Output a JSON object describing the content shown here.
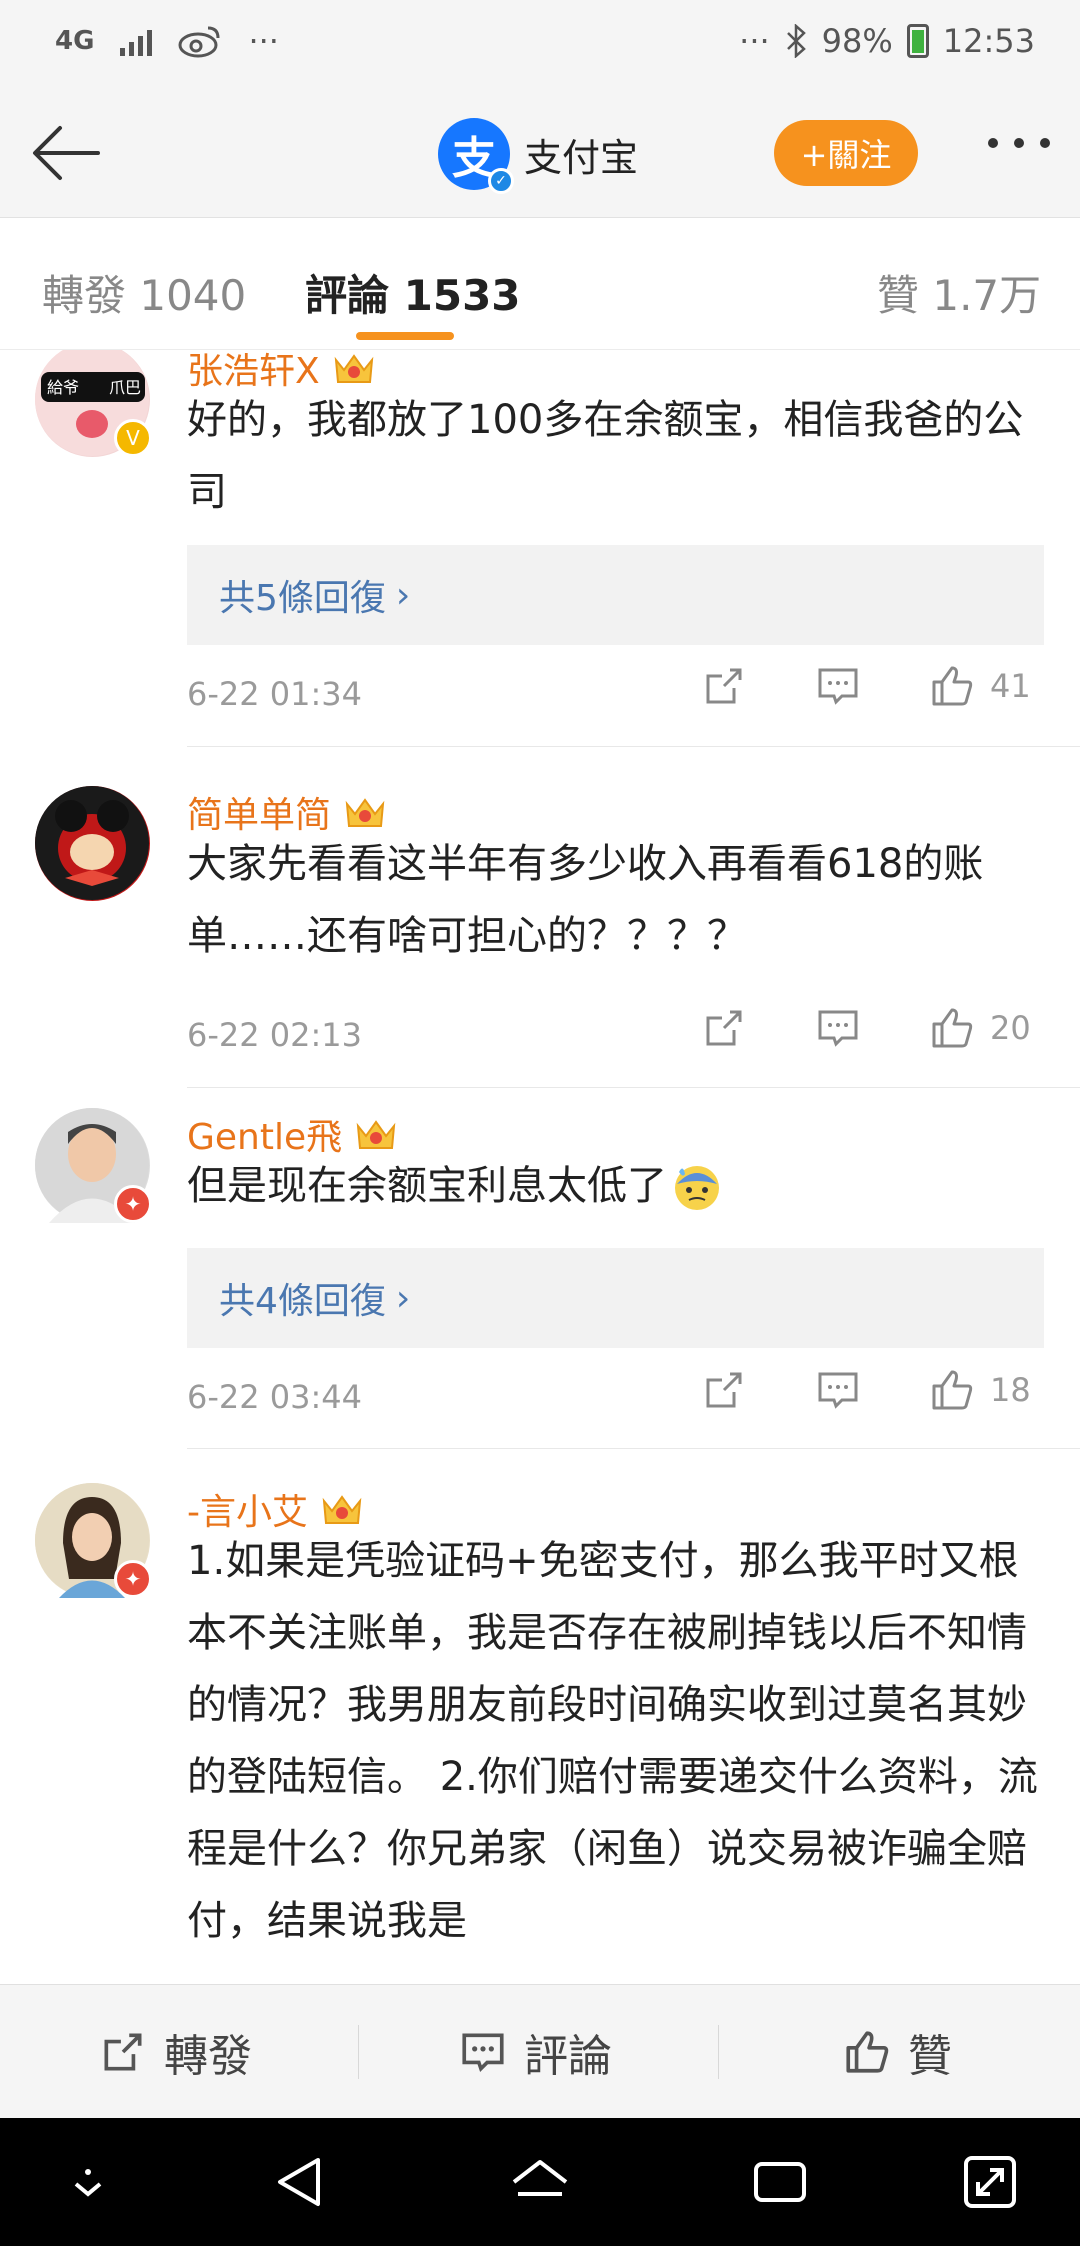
{
  "status_bar": {
    "network": "4G",
    "more": "···",
    "right_more": "···",
    "battery": "98%",
    "time": "12:53"
  },
  "header": {
    "title": "支付宝",
    "logo_char": "支",
    "follow_label": "+關注"
  },
  "tabs": {
    "repost": "轉發 1040",
    "comments": "評論 1533",
    "likes": "贊 1.7万"
  },
  "comments": [
    {
      "username": "张浩轩X",
      "text": "好的，我都放了100多在余额宝，相信我爸的公司",
      "replies": "共5條回復",
      "time": "6-22 01:34",
      "likes": "41",
      "avatar_text_left": "給爷",
      "avatar_text_right": "爪巴"
    },
    {
      "username": "简单单简",
      "text": "大家先看看这半年有多少收入再看看618的账单……还有啥可担心的？？？？",
      "replies": "",
      "time": "6-22 02:13",
      "likes": "20"
    },
    {
      "username": "Gentle飛",
      "text": "但是现在余额宝利息太低了",
      "replies": "共4條回復",
      "time": "6-22 03:44",
      "likes": "18"
    },
    {
      "username": "-言小艾",
      "text": "1.如果是凭验证码+免密支付，那么我平时又根本不关注账单，我是否存在被刷掉钱以后不知情的情况？我男朋友前段时间确实收到过莫名其妙的登陆短信。 2.你们赔付需要递交什么资料，流程是什么？你兄弟家（闲鱼）说交易被诈骗全赔付，结果说我是",
      "replies": "",
      "time": "",
      "likes": ""
    }
  ],
  "bottom_bar": {
    "repost": "轉發",
    "comment": "評論",
    "like": "贊"
  },
  "colors": {
    "accent_orange": "#f6921e",
    "username_orange": "#e8741a",
    "link_blue": "#4a77b0",
    "alipay_blue": "#1677ff"
  }
}
